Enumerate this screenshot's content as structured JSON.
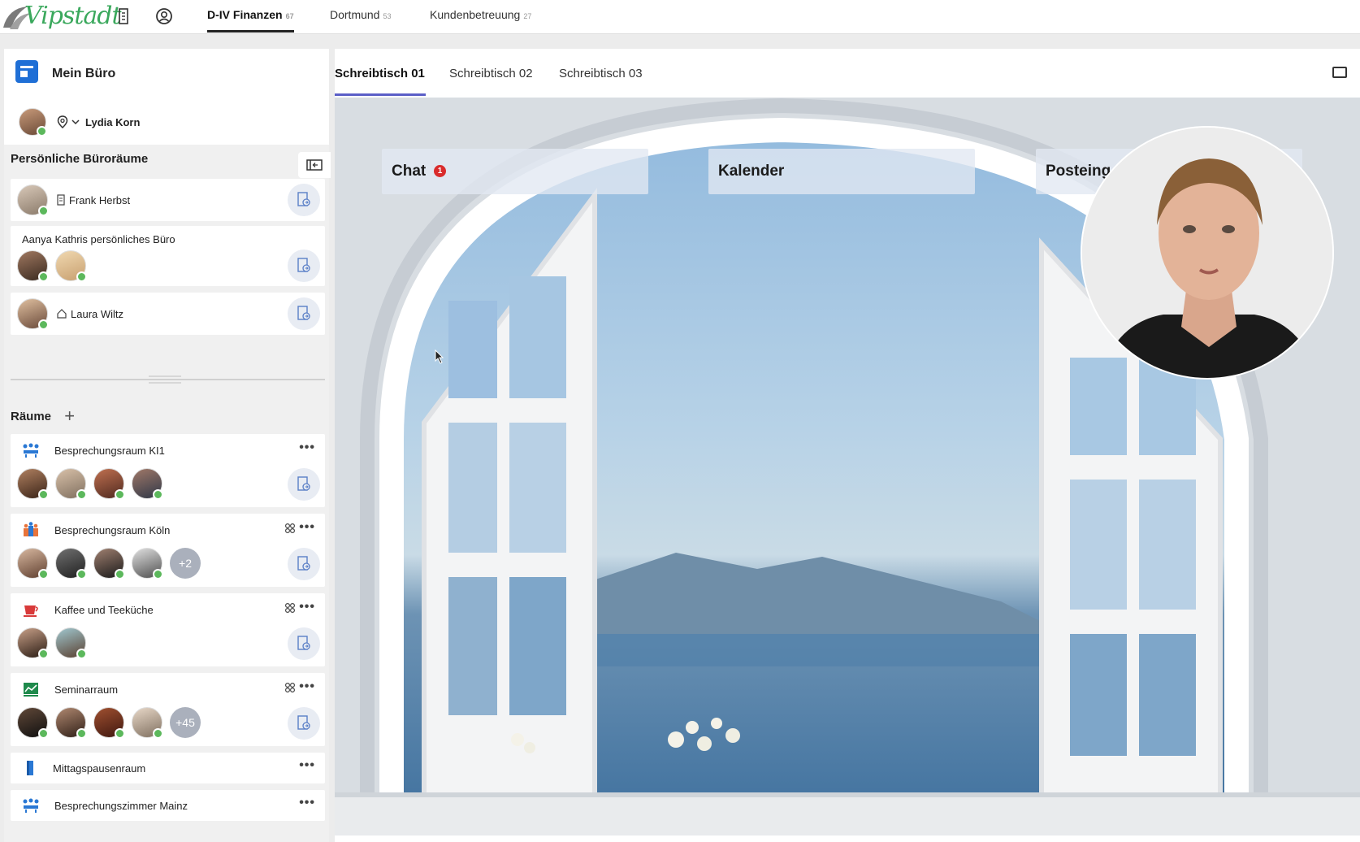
{
  "app": {
    "logo_text": "Vipstadt"
  },
  "topbar": {
    "tabs": [
      {
        "label": "D-IV Finanzen",
        "count": "67",
        "active": true
      },
      {
        "label": "Dortmund",
        "count": "53",
        "active": false
      },
      {
        "label": "Kundenbetreuung",
        "count": "27",
        "active": false
      }
    ]
  },
  "sidebar": {
    "title": "Mein Büro",
    "user": {
      "name": "Lydia Korn"
    },
    "personal_title": "Persönliche Büroräume",
    "personal": [
      {
        "label": "Frank Herbst"
      },
      {
        "label": "Aanya Kathris persönliches Büro"
      },
      {
        "label": "Laura Wiltz"
      }
    ],
    "rooms_title": "Räume",
    "rooms": [
      {
        "label": "Besprechungsraum KI1",
        "more": ""
      },
      {
        "label": "Besprechungsraum Köln",
        "more": "+2"
      },
      {
        "label": "Kaffee und Teeküche",
        "more": ""
      },
      {
        "label": "Seminarraum",
        "more": "+45"
      },
      {
        "label": "Mittagspausenraum",
        "more": ""
      },
      {
        "label": "Besprechungszimmer Mainz",
        "more": ""
      }
    ],
    "dots": "•••"
  },
  "main": {
    "desk_tabs": [
      {
        "label": "Schreibtisch 01",
        "active": true
      },
      {
        "label": "Schreibtisch 02",
        "active": false
      },
      {
        "label": "Schreibtisch 03",
        "active": false
      }
    ],
    "widgets": [
      {
        "title": "Chat",
        "badge": "1"
      },
      {
        "title": "Kalender"
      },
      {
        "title": "Posteing"
      }
    ]
  },
  "colors": {
    "accent": "#5b5fc7",
    "online": "#5cb85c",
    "badge": "#d92b2b",
    "brand": "#3aa85c"
  }
}
